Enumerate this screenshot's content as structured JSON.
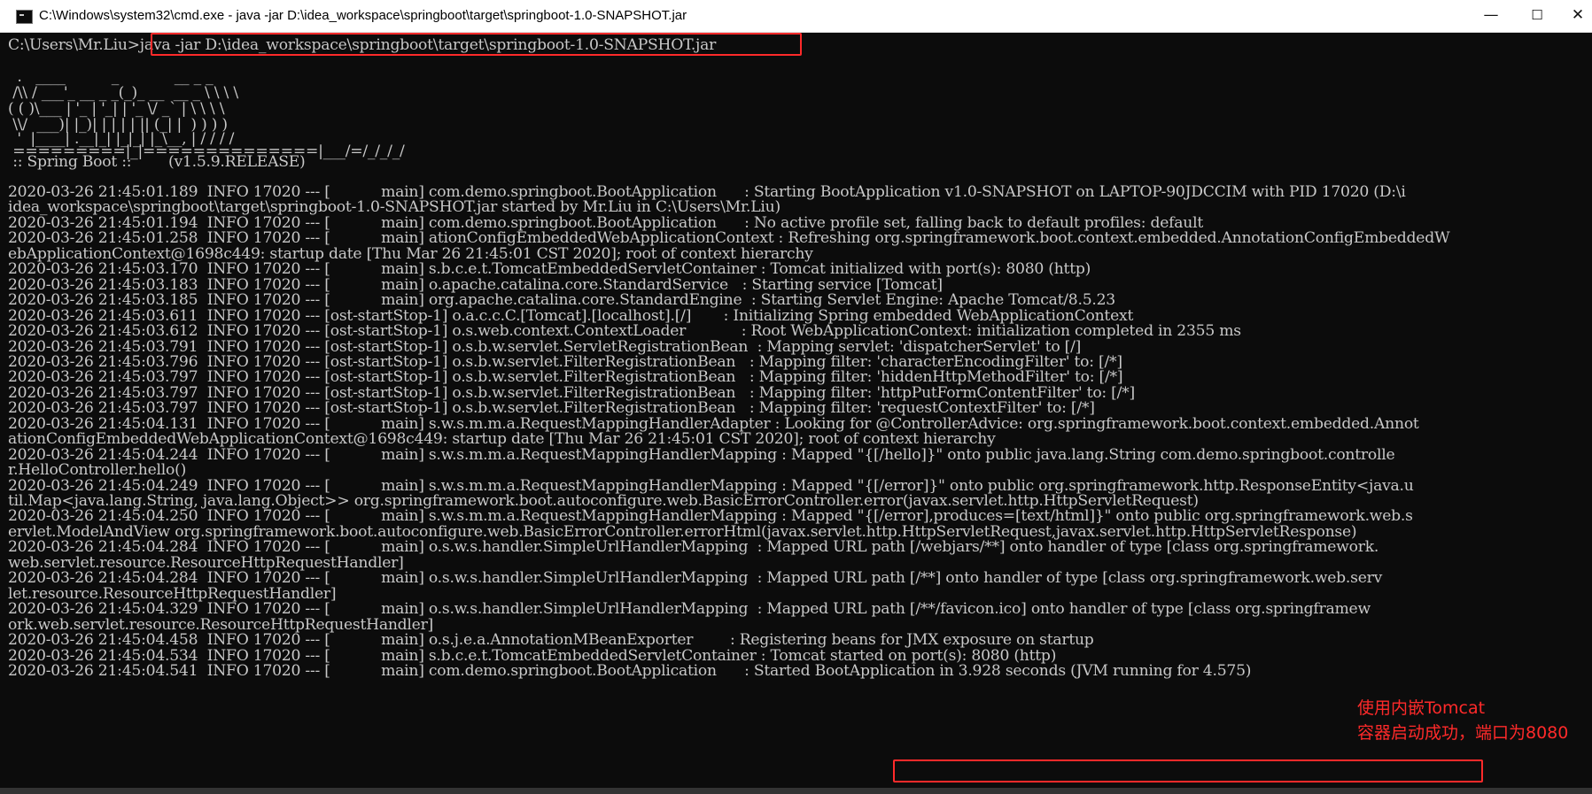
{
  "window": {
    "title": "C:\\Windows\\system32\\cmd.exe - java  -jar D:\\idea_workspace\\springboot\\target\\springboot-1.0-SNAPSHOT.jar",
    "controls": {
      "minimize": "—",
      "maximize": "☐",
      "close": "✕"
    }
  },
  "console": {
    "lines": [
      "C:\\Users\\Mr.Liu>java -jar D:\\idea_workspace\\springboot\\target\\springboot-1.0-SNAPSHOT.jar",
      "",
      "",
      "  .   ____          _            __ _ _",
      " /\\\\ / ___'_ __ _ _(_)_ __  __ _ \\ \\ \\ \\",
      "( ( )\\___ | '_ | '_| | '_ \\/ _` | \\ \\ \\ \\",
      " \\\\/  ___)| |_)| | | | | || (_| |  ) ) ) )",
      "  '  |____| .__|_| |_|_| |_\\__, | / / / /",
      " =========|_|==============|___/=/_/_/_/",
      " :: Spring Boot ::        (v1.5.9.RELEASE)",
      "",
      "2020-03-26 21:45:01.189  INFO 17020 --- [           main] com.demo.springboot.BootApplication      : Starting BootApplication v1.0-SNAPSHOT on LAPTOP-90JDCCIM with PID 17020 (D:\\i",
      "idea_workspace\\springboot\\target\\springboot-1.0-SNAPSHOT.jar started by Mr.Liu in C:\\Users\\Mr.Liu)",
      "2020-03-26 21:45:01.194  INFO 17020 --- [           main] com.demo.springboot.BootApplication      : No active profile set, falling back to default profiles: default",
      "2020-03-26 21:45:01.258  INFO 17020 --- [           main] ationConfigEmbeddedWebApplicationContext : Refreshing org.springframework.boot.context.embedded.AnnotationConfigEmbeddedW",
      "ebApplicationContext@1698c449: startup date [Thu Mar 26 21:45:01 CST 2020]; root of context hierarchy",
      "2020-03-26 21:45:03.170  INFO 17020 --- [           main] s.b.c.e.t.TomcatEmbeddedServletContainer : Tomcat initialized with port(s): 8080 (http)",
      "2020-03-26 21:45:03.183  INFO 17020 --- [           main] o.apache.catalina.core.StandardService   : Starting service [Tomcat]",
      "2020-03-26 21:45:03.185  INFO 17020 --- [           main] org.apache.catalina.core.StandardEngine  : Starting Servlet Engine: Apache Tomcat/8.5.23",
      "2020-03-26 21:45:03.611  INFO 17020 --- [ost-startStop-1] o.a.c.c.C.[Tomcat].[localhost].[/]       : Initializing Spring embedded WebApplicationContext",
      "2020-03-26 21:45:03.612  INFO 17020 --- [ost-startStop-1] o.s.web.context.ContextLoader            : Root WebApplicationContext: initialization completed in 2355 ms",
      "2020-03-26 21:45:03.791  INFO 17020 --- [ost-startStop-1] o.s.b.w.servlet.ServletRegistrationBean  : Mapping servlet: 'dispatcherServlet' to [/]",
      "2020-03-26 21:45:03.796  INFO 17020 --- [ost-startStop-1] o.s.b.w.servlet.FilterRegistrationBean   : Mapping filter: 'characterEncodingFilter' to: [/*]",
      "2020-03-26 21:45:03.797  INFO 17020 --- [ost-startStop-1] o.s.b.w.servlet.FilterRegistrationBean   : Mapping filter: 'hiddenHttpMethodFilter' to: [/*]",
      "2020-03-26 21:45:03.797  INFO 17020 --- [ost-startStop-1] o.s.b.w.servlet.FilterRegistrationBean   : Mapping filter: 'httpPutFormContentFilter' to: [/*]",
      "2020-03-26 21:45:03.797  INFO 17020 --- [ost-startStop-1] o.s.b.w.servlet.FilterRegistrationBean   : Mapping filter: 'requestContextFilter' to: [/*]",
      "2020-03-26 21:45:04.131  INFO 17020 --- [           main] s.w.s.m.m.a.RequestMappingHandlerAdapter : Looking for @ControllerAdvice: org.springframework.boot.context.embedded.Annot",
      "ationConfigEmbeddedWebApplicationContext@1698c449: startup date [Thu Mar 26 21:45:01 CST 2020]; root of context hierarchy",
      "2020-03-26 21:45:04.244  INFO 17020 --- [           main] s.w.s.m.m.a.RequestMappingHandlerMapping : Mapped \"{[/hello]}\" onto public java.lang.String com.demo.springboot.controlle",
      "r.HelloController.hello()",
      "2020-03-26 21:45:04.249  INFO 17020 --- [           main] s.w.s.m.m.a.RequestMappingHandlerMapping : Mapped \"{[/error]}\" onto public org.springframework.http.ResponseEntity<java.u",
      "til.Map<java.lang.String, java.lang.Object>> org.springframework.boot.autoconfigure.web.BasicErrorController.error(javax.servlet.http.HttpServletRequest)",
      "2020-03-26 21:45:04.250  INFO 17020 --- [           main] s.w.s.m.m.a.RequestMappingHandlerMapping : Mapped \"{[/error],produces=[text/html]}\" onto public org.springframework.web.s",
      "ervlet.ModelAndView org.springframework.boot.autoconfigure.web.BasicErrorController.errorHtml(javax.servlet.http.HttpServletRequest,javax.servlet.http.HttpServletResponse)",
      "2020-03-26 21:45:04.284  INFO 17020 --- [           main] o.s.w.s.handler.SimpleUrlHandlerMapping  : Mapped URL path [/webjars/**] onto handler of type [class org.springframework.",
      "web.servlet.resource.ResourceHttpRequestHandler]",
      "2020-03-26 21:45:04.284  INFO 17020 --- [           main] o.s.w.s.handler.SimpleUrlHandlerMapping  : Mapped URL path [/**] onto handler of type [class org.springframework.web.serv",
      "let.resource.ResourceHttpRequestHandler]",
      "2020-03-26 21:45:04.329  INFO 17020 --- [           main] o.s.w.s.handler.SimpleUrlHandlerMapping  : Mapped URL path [/**/favicon.ico] onto handler of type [class org.springframew",
      "ork.web.servlet.resource.ResourceHttpRequestHandler]",
      "2020-03-26 21:45:04.458  INFO 17020 --- [           main] o.s.j.e.a.AnnotationMBeanExporter        : Registering beans for JMX exposure on startup",
      "2020-03-26 21:45:04.534  INFO 17020 --- [           main] s.b.c.e.t.TomcatEmbeddedServletContainer : Tomcat started on port(s): 8080 (http)",
      "2020-03-26 21:45:04.541  INFO 17020 --- [           main] com.demo.springboot.BootApplication      : Started BootApplication in 3.928 seconds (JVM running for 4.575)"
    ]
  },
  "annotation": {
    "line1": "使用内嵌Tomcat",
    "line2": "容器启动成功，端口为8080",
    "color": "#ff2a2a"
  },
  "colors": {
    "console_bg": "#0c0c0c",
    "console_text": "#c8c8c8",
    "highlight": "#ff2a2a"
  }
}
